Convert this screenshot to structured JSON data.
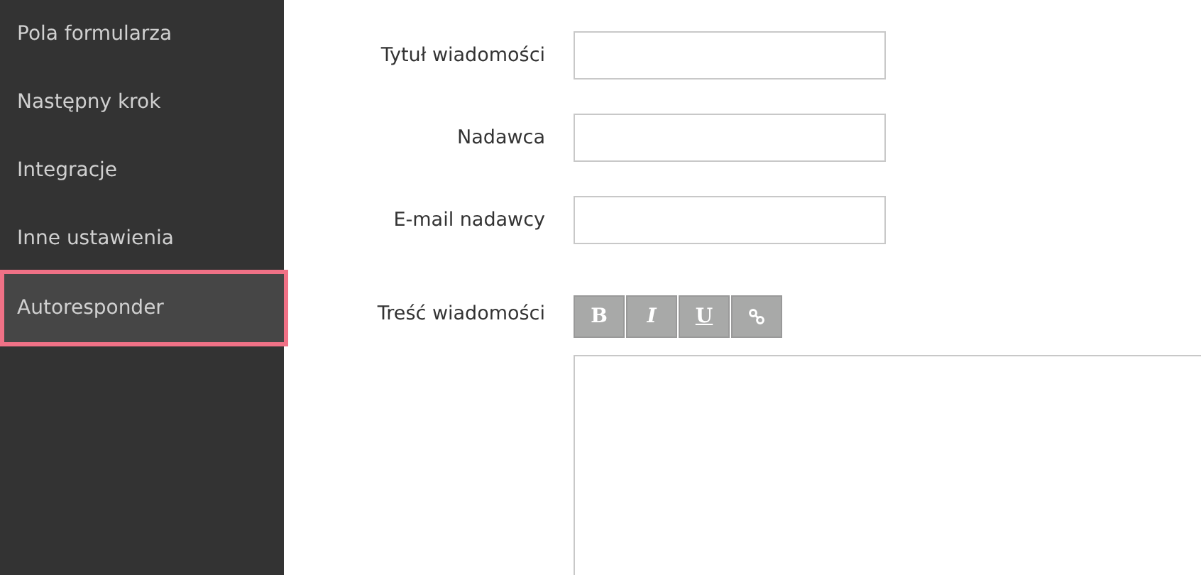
{
  "sidebar": {
    "items": [
      {
        "label": "Pola formularza",
        "selected": false
      },
      {
        "label": "Następny krok",
        "selected": false
      },
      {
        "label": "Integracje",
        "selected": false
      },
      {
        "label": "Inne ustawienia",
        "selected": false
      },
      {
        "label": "Autoresponder",
        "selected": true
      }
    ]
  },
  "form": {
    "fields": [
      {
        "label": "Tytuł wiadomości"
      },
      {
        "label": "Nadawca"
      },
      {
        "label": "E-mail nadawcy"
      }
    ],
    "body": {
      "label": "Treść wiadomości",
      "toolbar": [
        {
          "kind": "bold",
          "label": "B"
        },
        {
          "kind": "italic",
          "label": "I"
        },
        {
          "kind": "underline",
          "label": "U"
        },
        {
          "kind": "link"
        }
      ]
    }
  }
}
